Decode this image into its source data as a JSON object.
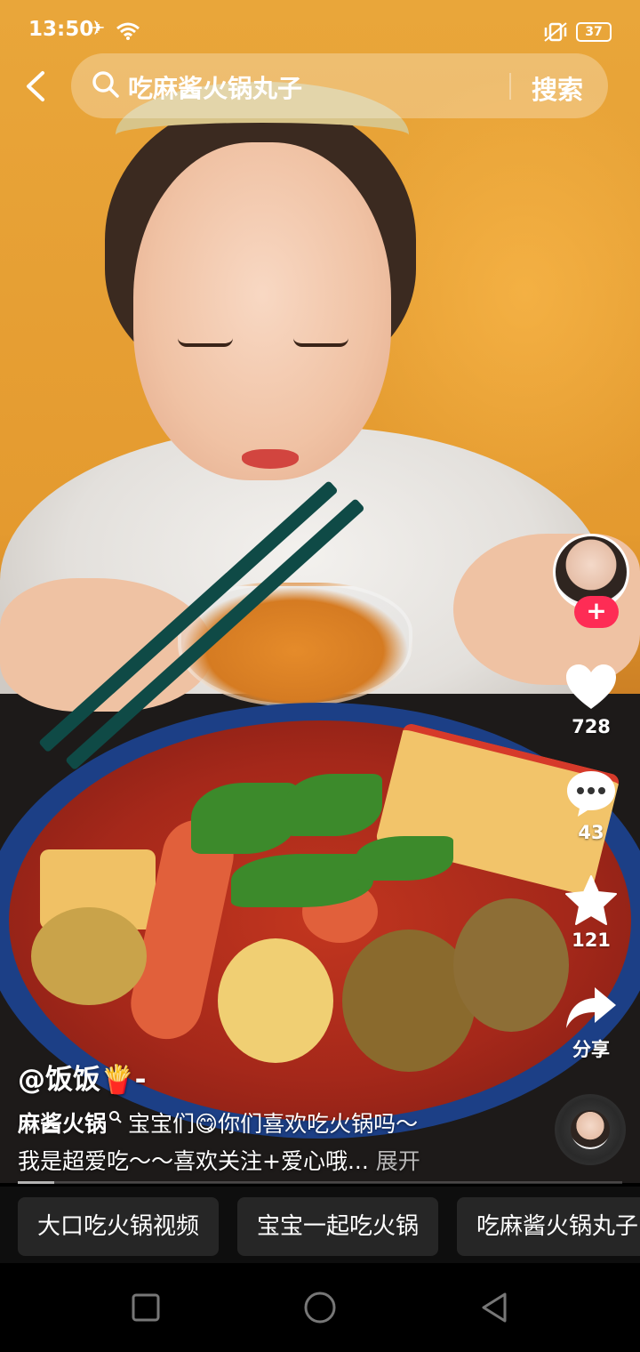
{
  "status_bar": {
    "time": "13:50",
    "battery": "37"
  },
  "search": {
    "query": "吃麻酱火锅丸子",
    "submit_label": "搜索"
  },
  "actions": {
    "follow_label": "+",
    "likes": "728",
    "comments": "43",
    "favorites": "121",
    "share_label": "分享"
  },
  "caption": {
    "author": "@饭饭🍟-",
    "tag": "麻酱火锅",
    "line1_text": "宝宝们😋你们喜欢吃火锅吗～",
    "line2_text": "我是超爱吃～～喜欢关注+爱心哦...",
    "expand_label": "展开"
  },
  "related": [
    "大口吃火锅视频",
    "宝宝一起吃火锅",
    "吃麻酱火锅丸子"
  ],
  "icons": {
    "back": "chevron-left-icon",
    "search": "search-icon",
    "like": "heart-icon",
    "comment": "comment-icon",
    "favorite": "star-icon",
    "share": "share-arrow-icon",
    "nav_recent": "square-icon",
    "nav_home": "circle-icon",
    "nav_back": "triangle-icon"
  },
  "playback": {
    "progress": 0.06
  }
}
